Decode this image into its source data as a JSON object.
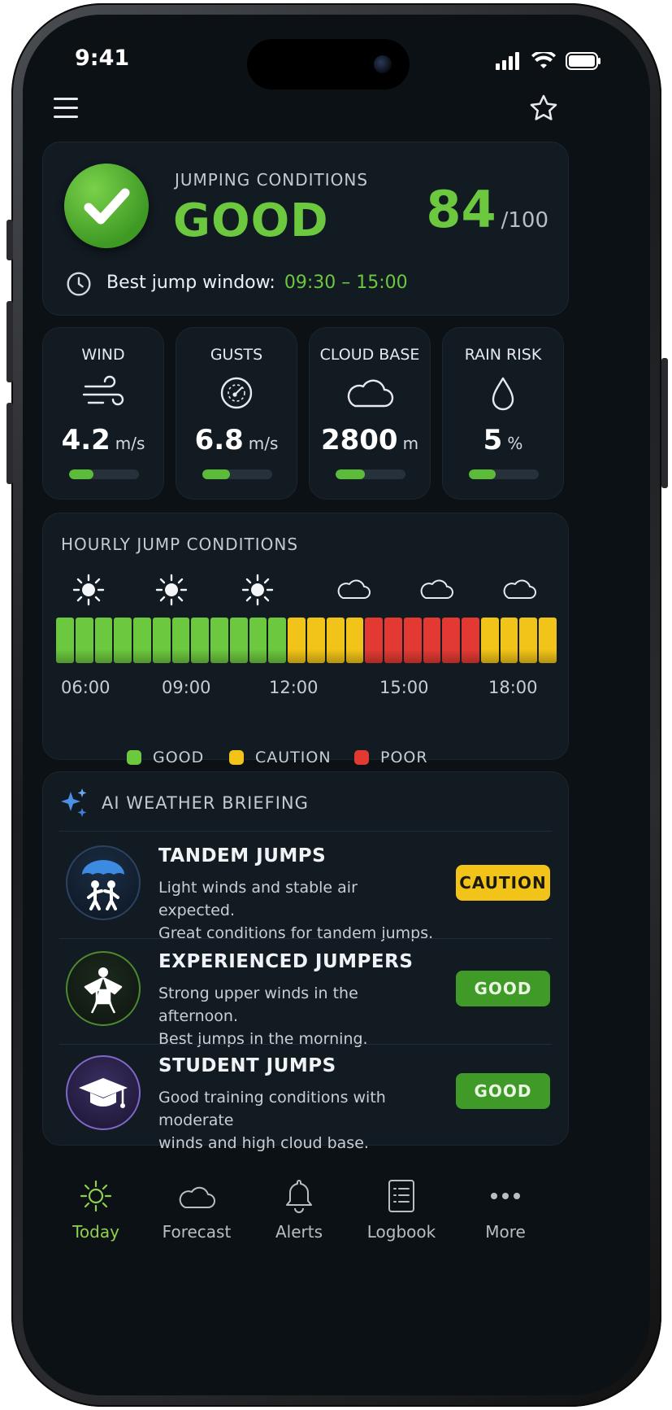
{
  "status_bar": {
    "time": "9:41"
  },
  "header": {
    "menu_icon": "hamburger-menu-icon",
    "favorite_icon": "star-outline-icon"
  },
  "conditions": {
    "heading": "JUMPING CONDITIONS",
    "status": "GOOD",
    "score": "84",
    "score_max": "/100",
    "window_label": "Best jump window:",
    "window_value": "09:30 – 15:00",
    "colors": {
      "good": "#6cc83e",
      "caution": "#f2c318",
      "poor": "#e23a33"
    }
  },
  "metrics": [
    {
      "label": "WIND",
      "value": "4.2",
      "unit": "m/s",
      "icon": "wind-icon",
      "level": 0.35
    },
    {
      "label": "GUSTS",
      "value": "6.8",
      "unit": "m/s",
      "icon": "gauge-icon",
      "level": 0.4
    },
    {
      "label": "CLOUD BASE",
      "value": "2800",
      "unit": "m",
      "icon": "cloud-icon",
      "level": 0.42
    },
    {
      "label": "RAIN RISK",
      "value": "5",
      "unit": "%",
      "icon": "raindrop-icon",
      "level": 0.38
    }
  ],
  "hourly": {
    "heading": "HOURLY JUMP CONDITIONS",
    "icons": [
      "sun-icon",
      "sun-icon",
      "sun-icon",
      "cloud-icon",
      "cloud-icon",
      "cloud-icon"
    ],
    "segments": [
      "good",
      "good",
      "good",
      "good",
      "good",
      "good",
      "good",
      "good",
      "good",
      "good",
      "good",
      "good",
      "caution",
      "caution",
      "caution",
      "caution",
      "poor",
      "poor",
      "poor",
      "poor",
      "poor",
      "poor",
      "caution",
      "caution",
      "caution",
      "caution"
    ],
    "time_labels": [
      "06:00",
      "09:00",
      "12:00",
      "15:00",
      "18:00"
    ],
    "legend": [
      {
        "label": "GOOD",
        "color": "#6cc83e"
      },
      {
        "label": "CAUTION",
        "color": "#f2c318"
      },
      {
        "label": "POOR",
        "color": "#e23a33"
      }
    ]
  },
  "briefing": {
    "heading": "AI WEATHER BRIEFING",
    "items": [
      {
        "title": "TANDEM JUMPS",
        "line1": "Light winds and stable air expected.",
        "line2": "Great conditions for tandem jumps.",
        "badge": "CAUTION",
        "icon": "tandem-parachute-icon"
      },
      {
        "title": "EXPERIENCED JUMPERS",
        "line1": "Strong upper winds in the afternoon.",
        "line2": "Best jumps in the morning.",
        "badge": "GOOD",
        "icon": "wingsuit-jumper-icon"
      },
      {
        "title": "STUDENT JUMPS",
        "line1": "Good training conditions with moderate",
        "line2": "winds and high cloud base.",
        "badge": "GOOD",
        "icon": "graduation-cap-icon"
      }
    ]
  },
  "nav": [
    {
      "label": "Today",
      "icon": "sun-icon",
      "active": true
    },
    {
      "label": "Forecast",
      "icon": "cloud-icon",
      "active": false
    },
    {
      "label": "Alerts",
      "icon": "bell-icon",
      "active": false
    },
    {
      "label": "Logbook",
      "icon": "logbook-icon",
      "active": false
    },
    {
      "label": "More",
      "icon": "more-dots-icon",
      "active": false
    }
  ]
}
